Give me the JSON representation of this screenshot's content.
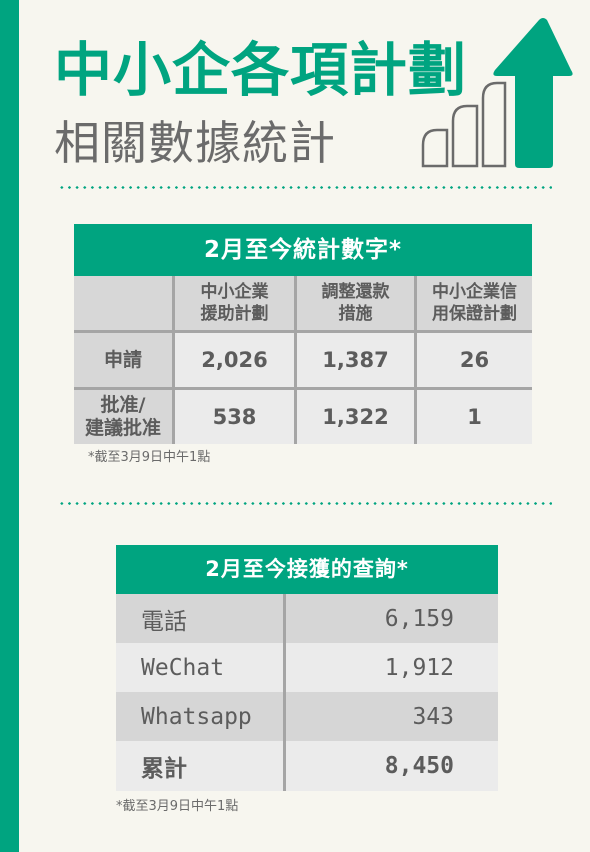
{
  "header": {
    "title": "中小企各項計劃",
    "subtitle": "相關數據統計",
    "icon": "bar-chart-up-arrow-icon",
    "accent_color": "#00a480",
    "text_gray": "#6b6b6b"
  },
  "stats_table": {
    "title": "2月至今統計數字*",
    "columns": [
      "",
      "中小企業\n援助計劃",
      "調整還款\n措施",
      "中小企業信\n用保證計劃"
    ],
    "rows": [
      {
        "label": "申請",
        "values": [
          "2,026",
          "1,387",
          "26"
        ]
      },
      {
        "label": "批准/\n建議批准",
        "values": [
          "538",
          "1,322",
          "1"
        ]
      }
    ],
    "note": "*截至3月9日中午1點"
  },
  "enquiries_table": {
    "title": "2月至今接獲的查詢*",
    "rows": [
      {
        "label": "電話",
        "value": "6,159"
      },
      {
        "label": "WeChat",
        "value": "1,912"
      },
      {
        "label": "Whatsapp",
        "value": "343"
      }
    ],
    "total": {
      "label": "累計",
      "value": "8,450"
    },
    "note": "*截至3月9日中午1點"
  }
}
